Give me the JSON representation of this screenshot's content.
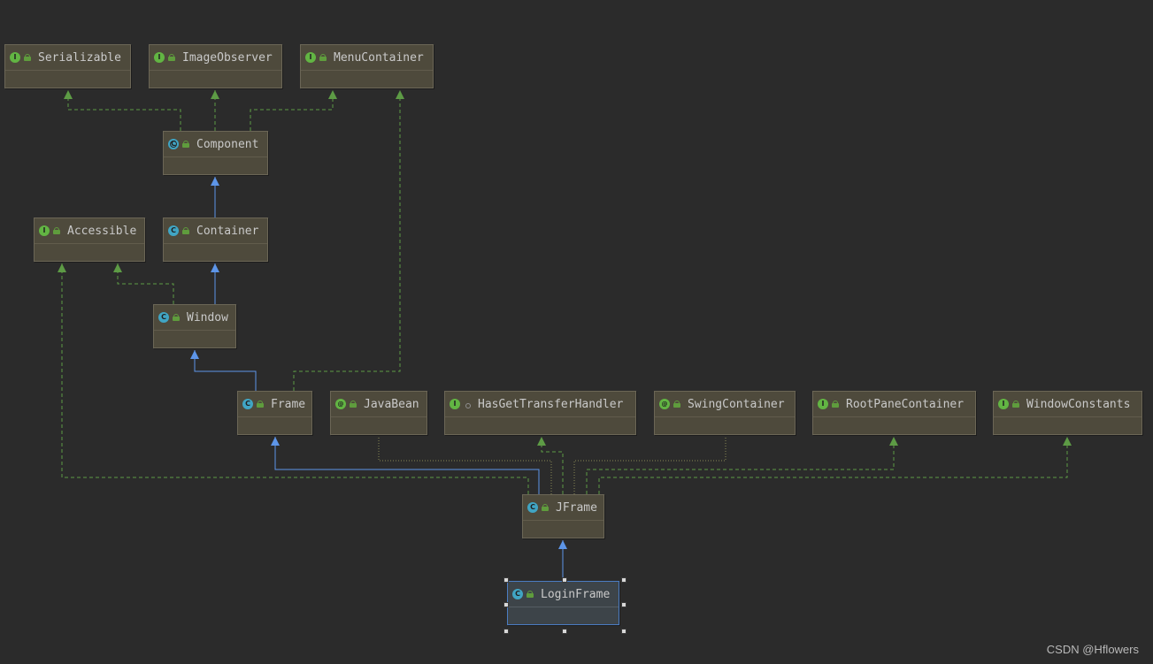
{
  "diagram": {
    "nodes": [
      {
        "id": "serializable",
        "label": "Serializable",
        "kind": "interface",
        "icon_letter": "I",
        "access": "public"
      },
      {
        "id": "imageobserver",
        "label": "ImageObserver",
        "kind": "interface",
        "icon_letter": "I",
        "access": "public"
      },
      {
        "id": "menucontainer",
        "label": "MenuContainer",
        "kind": "interface",
        "icon_letter": "I",
        "access": "public"
      },
      {
        "id": "component",
        "label": "Component",
        "kind": "abstract",
        "icon_letter": "C",
        "access": "public"
      },
      {
        "id": "accessible",
        "label": "Accessible",
        "kind": "interface",
        "icon_letter": "I",
        "access": "public"
      },
      {
        "id": "container",
        "label": "Container",
        "kind": "class",
        "icon_letter": "C",
        "access": "public"
      },
      {
        "id": "window",
        "label": "Window",
        "kind": "class",
        "icon_letter": "C",
        "access": "public"
      },
      {
        "id": "frame",
        "label": "Frame",
        "kind": "class",
        "icon_letter": "C",
        "access": "public"
      },
      {
        "id": "javabean",
        "label": "JavaBean",
        "kind": "annotation",
        "icon_letter": "@",
        "access": "public"
      },
      {
        "id": "hasgettransferhandler",
        "label": "HasGetTransferHandler",
        "kind": "functional",
        "icon_letter": "I",
        "access": "package"
      },
      {
        "id": "swingcontainer",
        "label": "SwingContainer",
        "kind": "annotation",
        "icon_letter": "@",
        "access": "public"
      },
      {
        "id": "rootpanecontainer",
        "label": "RootPaneContainer",
        "kind": "interface",
        "icon_letter": "I",
        "access": "public"
      },
      {
        "id": "windowconstants",
        "label": "WindowConstants",
        "kind": "interface",
        "icon_letter": "I",
        "access": "public"
      },
      {
        "id": "jframe",
        "label": "JFrame",
        "kind": "class",
        "icon_letter": "C",
        "access": "public"
      },
      {
        "id": "loginframe",
        "label": "LoginFrame",
        "kind": "class",
        "icon_letter": "C",
        "access": "public",
        "selected": true
      }
    ],
    "edges": [
      {
        "from": "component",
        "to": "serializable",
        "type": "implements"
      },
      {
        "from": "component",
        "to": "imageobserver",
        "type": "implements"
      },
      {
        "from": "component",
        "to": "menucontainer",
        "type": "implements"
      },
      {
        "from": "container",
        "to": "component",
        "type": "extends"
      },
      {
        "from": "window",
        "to": "container",
        "type": "extends"
      },
      {
        "from": "window",
        "to": "accessible",
        "type": "implements"
      },
      {
        "from": "frame",
        "to": "window",
        "type": "extends"
      },
      {
        "from": "frame",
        "to": "menucontainer",
        "type": "implements"
      },
      {
        "from": "jframe",
        "to": "frame",
        "type": "extends"
      },
      {
        "from": "jframe",
        "to": "accessible",
        "type": "implements"
      },
      {
        "from": "jframe",
        "to": "javabean",
        "type": "annotated"
      },
      {
        "from": "jframe",
        "to": "hasgettransferhandler",
        "type": "implements"
      },
      {
        "from": "jframe",
        "to": "swingcontainer",
        "type": "annotated"
      },
      {
        "from": "jframe",
        "to": "rootpanecontainer",
        "type": "implements"
      },
      {
        "from": "jframe",
        "to": "windowconstants",
        "type": "implements"
      },
      {
        "from": "loginframe",
        "to": "jframe",
        "type": "extends"
      }
    ],
    "colors": {
      "background": "#2b2b2b",
      "node_fill": "#4e4a3c",
      "node_border": "#6b6656",
      "extends_line": "#5d95e8",
      "implements_line": "#5d9b45",
      "annotation_line": "#8a8a54",
      "selection_border": "#4b7cc2"
    }
  },
  "watermark": "CSDN @Hflowers"
}
